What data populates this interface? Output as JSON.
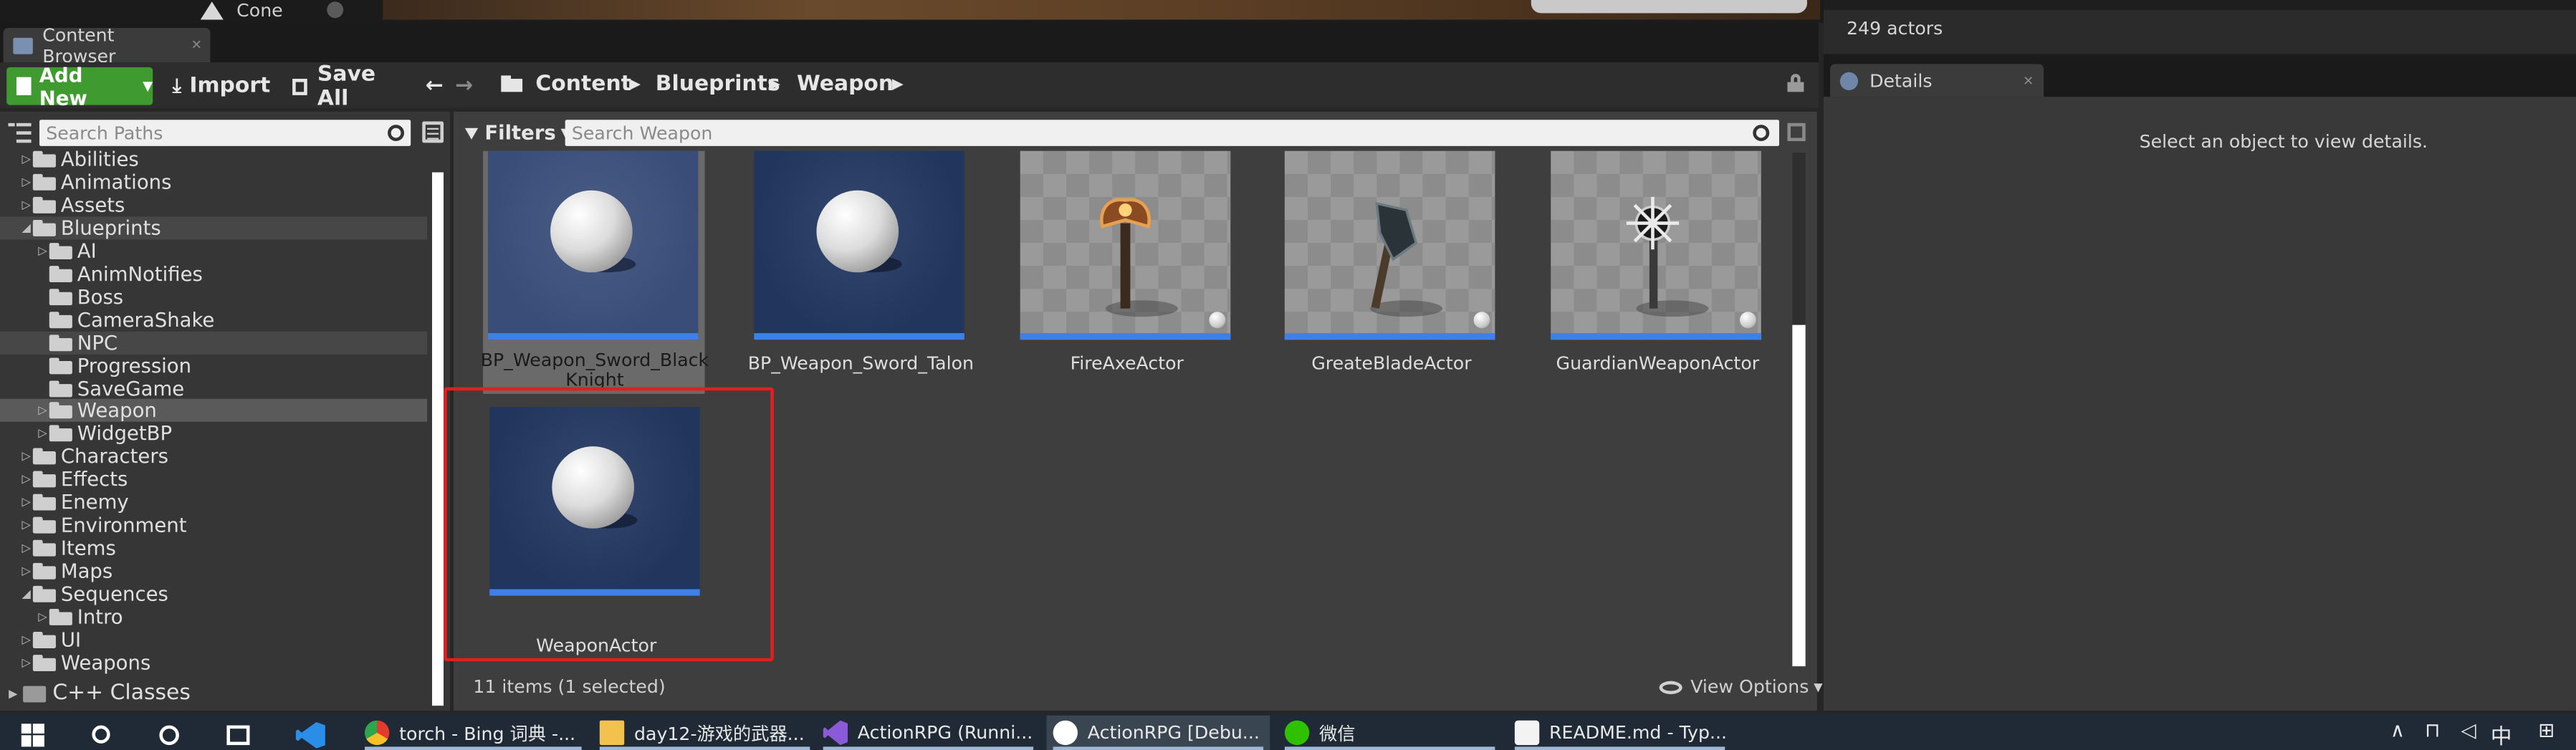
{
  "top": {
    "cone_label": "Cone"
  },
  "tab": {
    "title": "Content Browser"
  },
  "toolbar": {
    "add_new": "Add New",
    "import": "Import",
    "save_all": "Save All"
  },
  "breadcrumb": [
    "Content",
    "Blueprints",
    "Weapon"
  ],
  "sidebar": {
    "search_placeholder": "Search Paths",
    "items": [
      {
        "label": "Abilities",
        "level": 1,
        "arrow": "right"
      },
      {
        "label": "Animations",
        "level": 1,
        "arrow": "right"
      },
      {
        "label": "Assets",
        "level": 1,
        "arrow": "right"
      },
      {
        "label": "Blueprints",
        "level": 1,
        "arrow": "down"
      },
      {
        "label": "AI",
        "level": 2,
        "arrow": "right"
      },
      {
        "label": "AnimNotifies",
        "level": 2,
        "arrow": ""
      },
      {
        "label": "Boss",
        "level": 2,
        "arrow": ""
      },
      {
        "label": "CameraShake",
        "level": 2,
        "arrow": ""
      },
      {
        "label": "NPC",
        "level": 2,
        "arrow": ""
      },
      {
        "label": "Progression",
        "level": 2,
        "arrow": ""
      },
      {
        "label": "SaveGame",
        "level": 2,
        "arrow": ""
      },
      {
        "label": "Weapon",
        "level": 2,
        "arrow": "right"
      },
      {
        "label": "WidgetBP",
        "level": 2,
        "arrow": "right"
      },
      {
        "label": "Characters",
        "level": 1,
        "arrow": "right"
      },
      {
        "label": "Effects",
        "level": 1,
        "arrow": "right"
      },
      {
        "label": "Enemy",
        "level": 1,
        "arrow": "right"
      },
      {
        "label": "Environment",
        "level": 1,
        "arrow": "right"
      },
      {
        "label": "Items",
        "level": 1,
        "arrow": "right"
      },
      {
        "label": "Maps",
        "level": 1,
        "arrow": "right"
      },
      {
        "label": "Sequences",
        "level": 1,
        "arrow": "down"
      },
      {
        "label": "Intro",
        "level": 2,
        "arrow": "right"
      },
      {
        "label": "UI",
        "level": 1,
        "arrow": "right"
      },
      {
        "label": "Weapons",
        "level": 1,
        "arrow": "right"
      }
    ],
    "cpp_classes": "C++ Classes"
  },
  "content": {
    "filters_label": "Filters",
    "search_placeholder": "Search Weapon",
    "assets": [
      {
        "name": "BP_Weapon_Sword_Black\nKnight",
        "thumb": "sphere",
        "icon": "sphere-thumbnail-icon"
      },
      {
        "name": "BP_Weapon_Sword_Talon",
        "thumb": "sphere",
        "icon": "sphere-thumbnail-icon"
      },
      {
        "name": "FireAxeActor",
        "thumb": "axe",
        "icon": "fire-axe-icon"
      },
      {
        "name": "GreateBladeActor",
        "thumb": "blade",
        "icon": "great-blade-icon"
      },
      {
        "name": "GuardianWeaponActor",
        "thumb": "mace",
        "icon": "mace-icon"
      },
      {
        "name": "WeaponActor",
        "thumb": "sphere",
        "icon": "sphere-thumbnail-icon"
      }
    ],
    "status": "11 items (1 selected)",
    "view_options": "View Options"
  },
  "right": {
    "actors": "249 actors",
    "details_tab": "Details",
    "details_message": "Select an object to view details."
  },
  "taskbar": {
    "items": [
      {
        "label": "torch - Bing 词典 -...",
        "icon": "chrome-icon"
      },
      {
        "label": "day12-游戏的武器...",
        "icon": "folder-icon"
      },
      {
        "label": "ActionRPG (Runni...",
        "icon": "visual-studio-icon"
      },
      {
        "label": "ActionRPG [Debu...",
        "icon": "unreal-icon"
      },
      {
        "label": "微信",
        "icon": "wechat-icon"
      },
      {
        "label": "README.md - Typ...",
        "icon": "typora-icon"
      }
    ],
    "tray_lang": "中"
  },
  "colors": {
    "add_new_green": "#3f9a2f",
    "selection_red": "#e02020",
    "accent_blue": "#3f80e8"
  }
}
